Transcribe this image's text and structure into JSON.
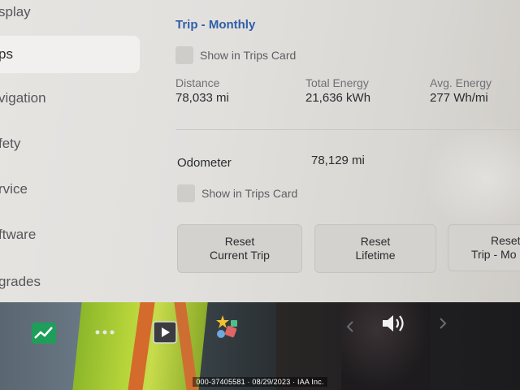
{
  "sidebar": {
    "items": [
      {
        "label": "splay",
        "active": false
      },
      {
        "label": "ps",
        "active": true
      },
      {
        "label": "vigation",
        "active": false
      },
      {
        "label": "fety",
        "active": false
      },
      {
        "label": "rvice",
        "active": false
      },
      {
        "label": "ftware",
        "active": false
      },
      {
        "label": "grades",
        "active": false
      }
    ]
  },
  "trip_monthly": {
    "title": "Trip - Monthly",
    "show_in_trips_card": "Show in Trips Card",
    "distance_label": "Distance",
    "distance_value": "78,033 mi",
    "energy_label": "Total Energy",
    "energy_value": "21,636 kWh",
    "avg_label": "Avg. Energy",
    "avg_value": "277 Wh/mi"
  },
  "odometer": {
    "label": "Odometer",
    "value": "78,129 mi",
    "show_in_trips_card": "Show in Trips Card"
  },
  "buttons": {
    "reset_current_trip": [
      "Reset",
      "Current Trip"
    ],
    "reset_lifetime": [
      "Reset",
      "Lifetime"
    ],
    "reset_trip_monthly": [
      "Reset",
      "Trip - Mo"
    ]
  },
  "taskbar": {
    "icons": [
      "chart-icon",
      "more-icon",
      "play-icon",
      "games-icon",
      "chevron-left-icon",
      "volume-icon",
      "chevron-right-icon"
    ]
  },
  "watermark": "000-37405581 · 08/29/2023 · IAA Inc.",
  "colors": {
    "accent": "#2f5ea8",
    "screen_bg": "#e2e0dd"
  }
}
